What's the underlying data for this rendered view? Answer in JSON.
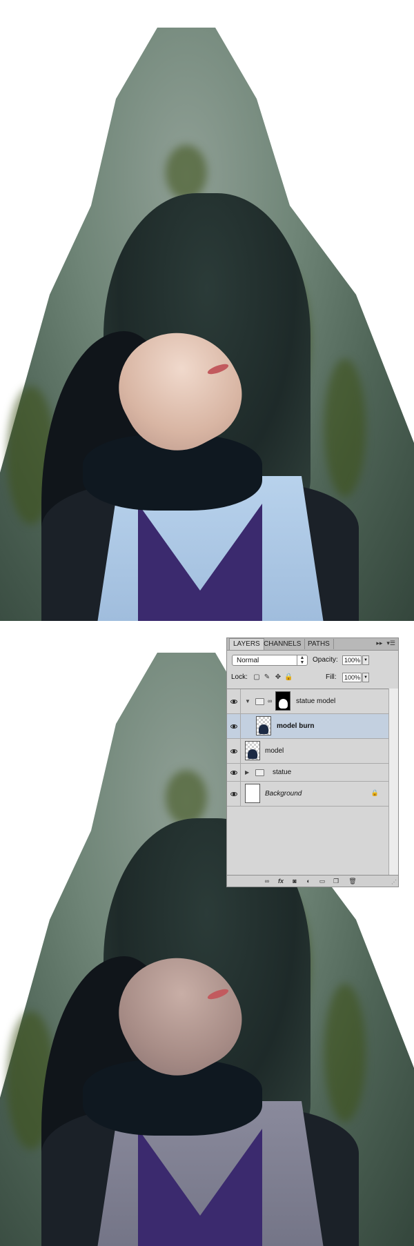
{
  "layers_panel": {
    "tabs": [
      {
        "label": "LAYERS",
        "active": true
      },
      {
        "label": "CHANNELS",
        "active": false
      },
      {
        "label": "PATHS",
        "active": false
      }
    ],
    "blend_mode": "Normal",
    "opacity_label": "Opacity:",
    "opacity_value": "100%",
    "lock_label": "Lock:",
    "fill_label": "Fill:",
    "fill_value": "100%",
    "layers": [
      {
        "name": "statue model",
        "type": "group",
        "expanded": true,
        "has_mask": true
      },
      {
        "name": "model burn",
        "type": "layer",
        "selected": true,
        "clipped": true
      },
      {
        "name": "model",
        "type": "layer"
      },
      {
        "name": "statue",
        "type": "group",
        "expanded": false
      },
      {
        "name": "Background",
        "type": "background",
        "locked": true
      }
    ],
    "footer_icons": [
      "link-icon",
      "fx-icon",
      "mask-icon",
      "adjustment-icon",
      "folder-icon",
      "new-layer-icon",
      "trash-icon"
    ]
  },
  "colors": {
    "panel_bg": "#d6d6d6",
    "selected_row": "#c3d0e0",
    "cloak_stone": "#6f8577"
  }
}
